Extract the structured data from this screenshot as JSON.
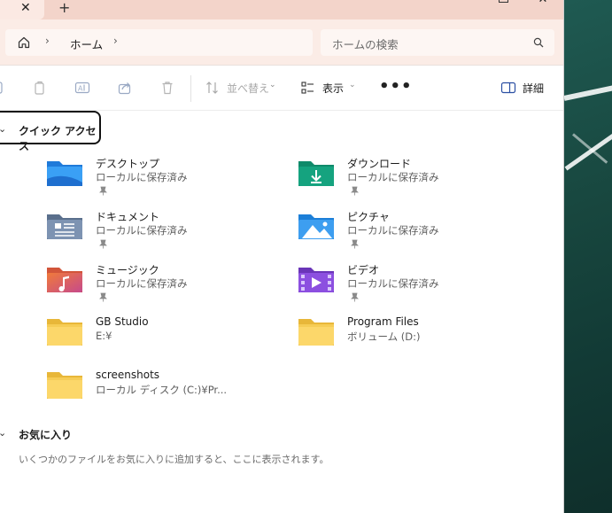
{
  "titlebar": {
    "close_tab": "✕",
    "new_tab": "+"
  },
  "address": {
    "breadcrumb_label": "ホーム",
    "search_placeholder": "ホームの検索"
  },
  "toolbar": {
    "sort_label": "並べ替え",
    "view_label": "表示",
    "more_label": "•••",
    "details_label": "詳細"
  },
  "sections": {
    "quick_access": "クイック アクセス",
    "favorites": "お気に入り"
  },
  "quick_access_items": [
    {
      "name": "デスクトップ",
      "sub": "ローカルに保存済み",
      "icon": "desktop-folder-icon",
      "pinned": true
    },
    {
      "name": "ダウンロード",
      "sub": "ローカルに保存済み",
      "icon": "downloads-folder-icon",
      "pinned": true
    },
    {
      "name": "ドキュメント",
      "sub": "ローカルに保存済み",
      "icon": "documents-folder-icon",
      "pinned": true
    },
    {
      "name": "ピクチャ",
      "sub": "ローカルに保存済み",
      "icon": "pictures-folder-icon",
      "pinned": true
    },
    {
      "name": "ミュージック",
      "sub": "ローカルに保存済み",
      "icon": "music-folder-icon",
      "pinned": true
    },
    {
      "name": "ビデオ",
      "sub": "ローカルに保存済み",
      "icon": "videos-folder-icon",
      "pinned": true
    },
    {
      "name": "GB Studio",
      "sub": "E:¥",
      "icon": "folder-icon",
      "pinned": false
    },
    {
      "name": "Program Files",
      "sub": "ボリューム (D:)",
      "icon": "folder-icon",
      "pinned": false
    },
    {
      "name": "screenshots",
      "sub": "ローカル ディスク (C:)¥Pr...",
      "icon": "folder-icon",
      "pinned": false
    }
  ],
  "favorites_empty": "いくつかのファイルをお気に入りに追加すると、ここに表示されます。",
  "colors": {
    "titlebar": "#f3d4ca",
    "addressbar": "#fbece6",
    "wallpaper": "#1a4b44"
  }
}
